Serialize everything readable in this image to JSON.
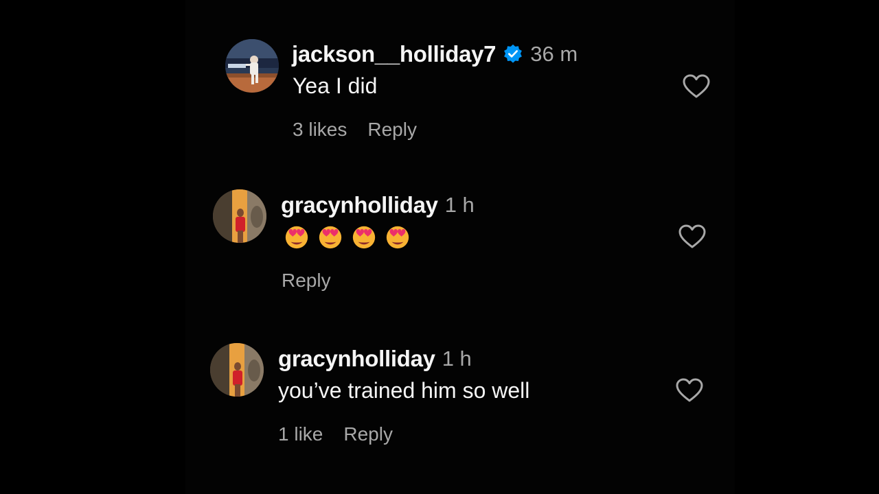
{
  "comments": [
    {
      "username": "jackson__holliday7",
      "verified": true,
      "time": "36 m",
      "text": "Yea I did",
      "likes_label": "3 likes",
      "reply_label": "Reply",
      "avatar": "baseball-player-photo"
    },
    {
      "username": "gracynholliday",
      "verified": false,
      "time": "1 h",
      "emojis": [
        "😍",
        "😍",
        "😍",
        "😍"
      ],
      "reply_label": "Reply",
      "avatar": "woman-red-dress-photo"
    },
    {
      "username": "gracynholliday",
      "verified": false,
      "time": "1 h",
      "text": "you’ve trained him so well",
      "likes_label": "1 like",
      "reply_label": "Reply",
      "avatar": "woman-red-dress-photo"
    }
  ],
  "colors": {
    "background": "#000000",
    "primary_text": "#f5f5f5",
    "secondary_text": "#a8a8a8",
    "verified_blue": "#0095f6"
  }
}
